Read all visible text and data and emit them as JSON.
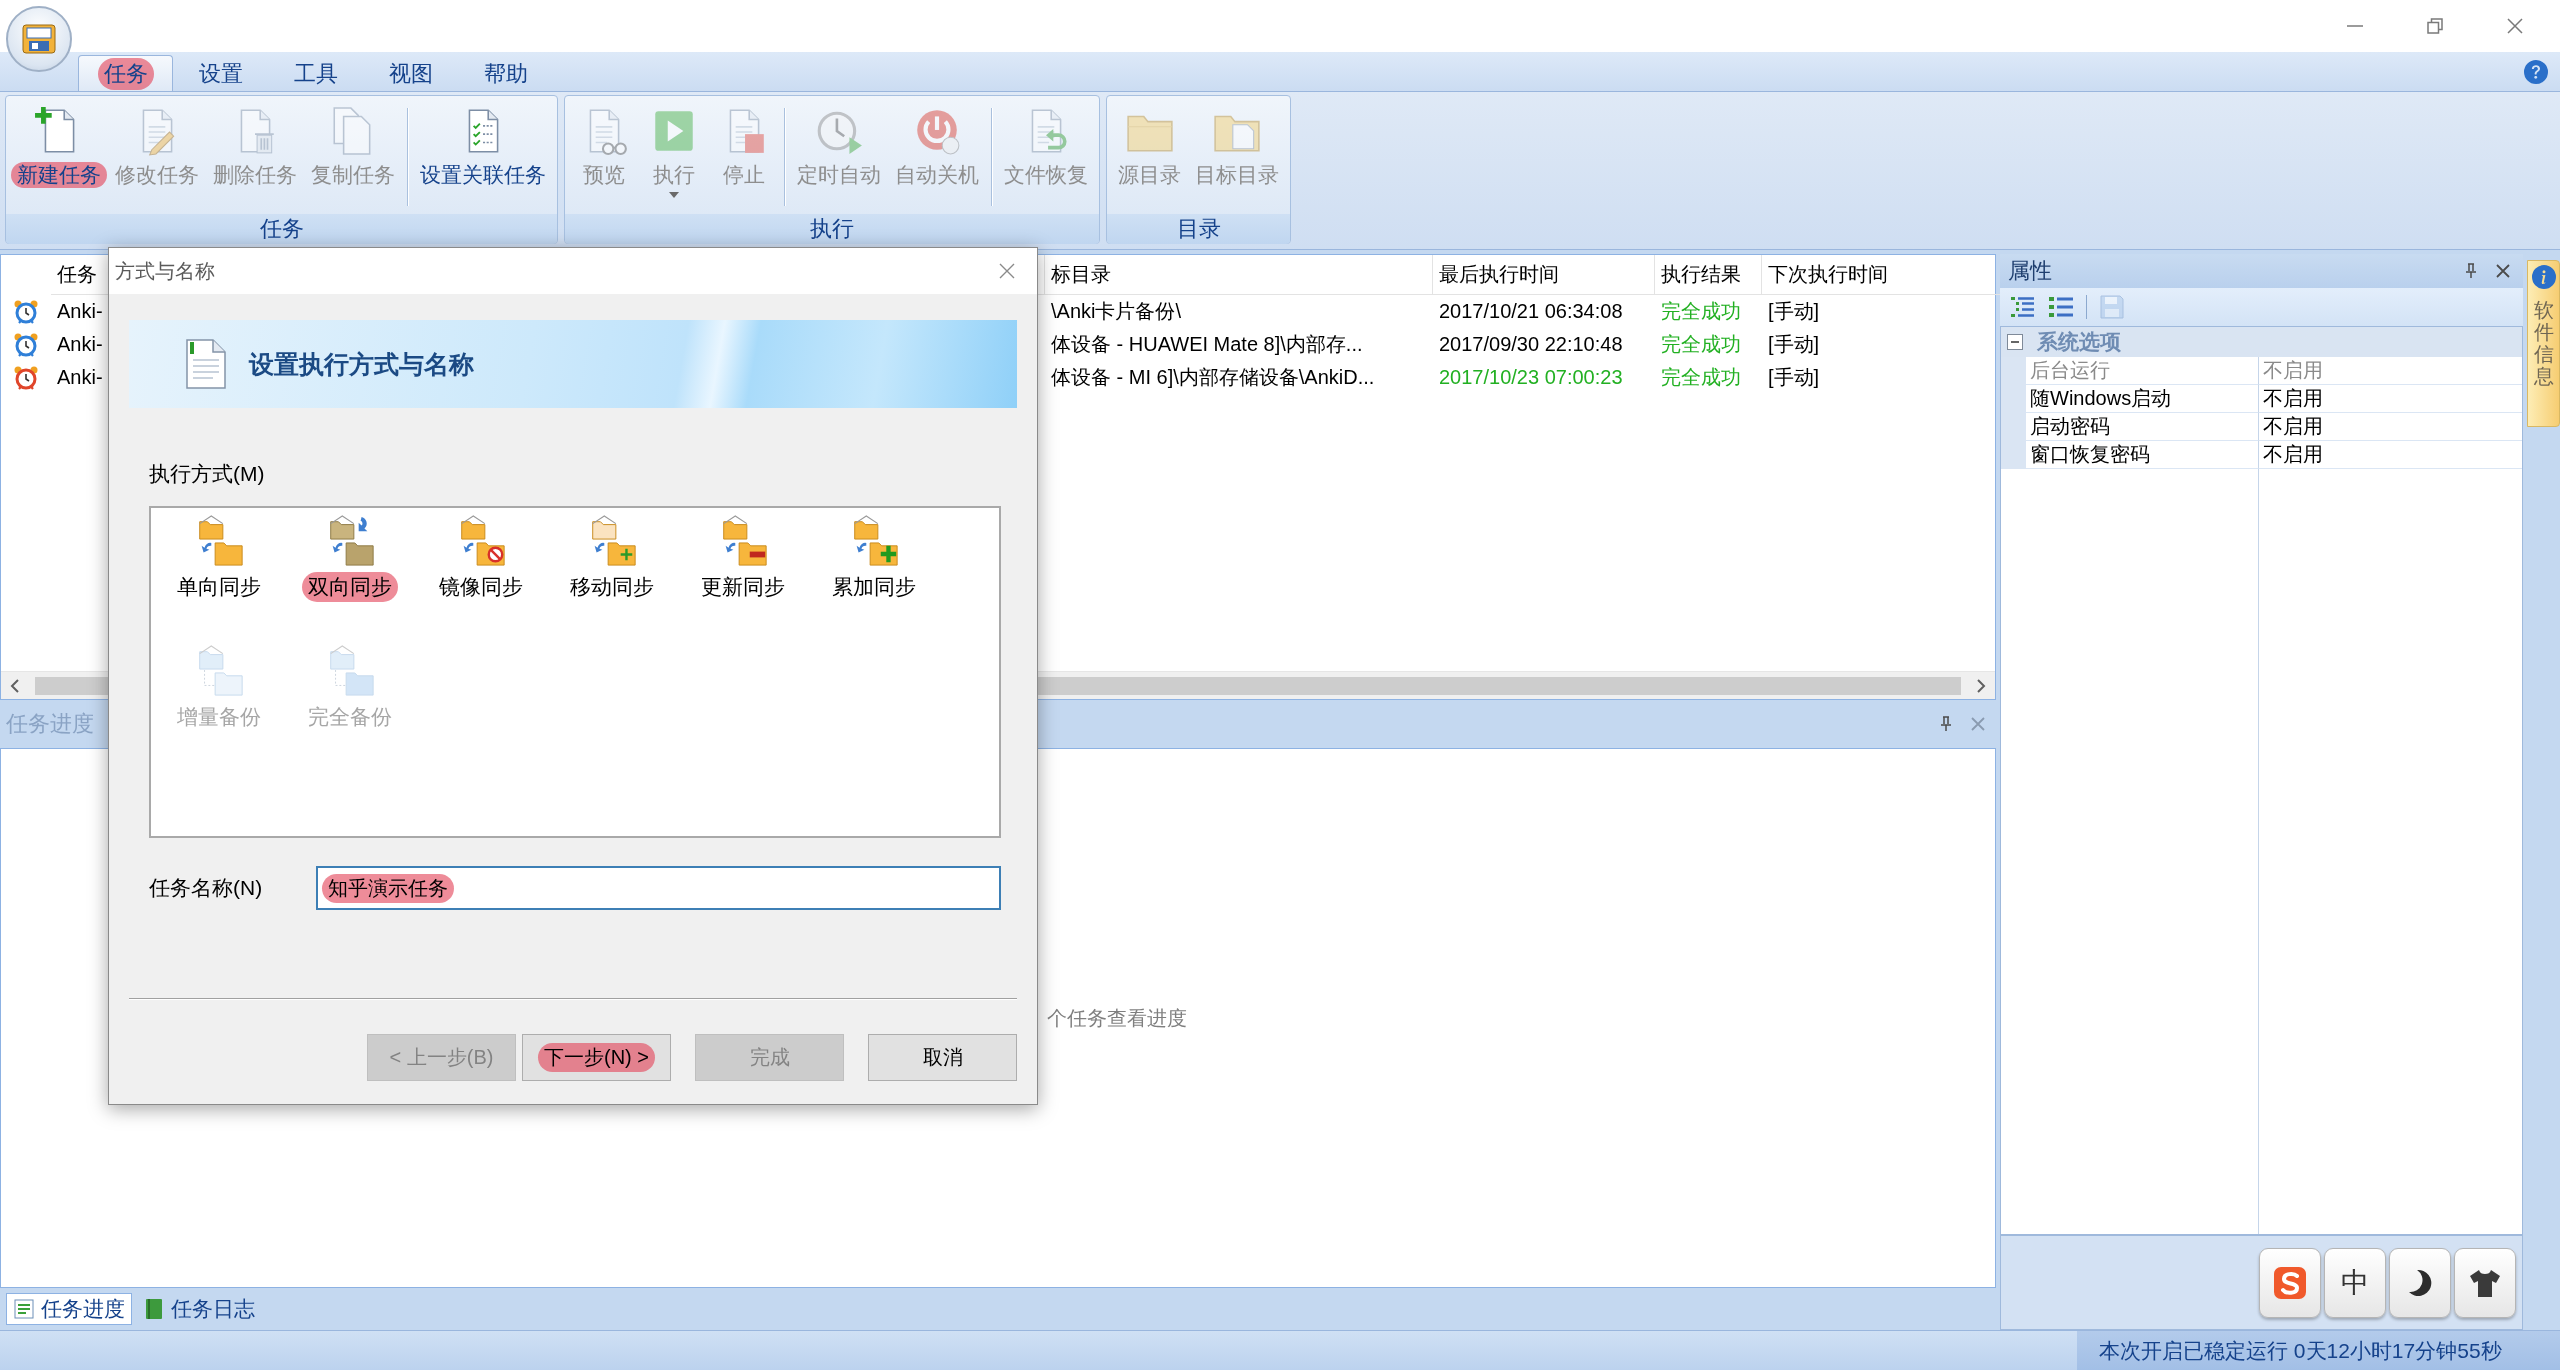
{
  "menu_tabs": [
    {
      "label": "任务",
      "selected": true,
      "highlighted": true
    },
    {
      "label": "设置",
      "selected": false,
      "highlighted": false
    },
    {
      "label": "工具",
      "selected": false,
      "highlighted": false
    },
    {
      "label": "视图",
      "selected": false,
      "highlighted": false
    },
    {
      "label": "帮助",
      "selected": false,
      "highlighted": false
    }
  ],
  "ribbon": {
    "groups": [
      {
        "label": "任务",
        "sections": [
          [
            {
              "kind": "new",
              "label": "新建任务",
              "disabled": false,
              "dropdown": false,
              "highlighted": true
            },
            {
              "kind": "edit",
              "label": "修改任务",
              "disabled": true,
              "dropdown": false,
              "highlighted": false
            },
            {
              "kind": "delete",
              "label": "删除任务",
              "disabled": true,
              "dropdown": false,
              "highlighted": false
            },
            {
              "kind": "copy",
              "label": "复制任务",
              "disabled": true,
              "dropdown": false,
              "highlighted": false
            }
          ],
          [
            {
              "kind": "link",
              "label": "设置关联任务",
              "disabled": false,
              "dropdown": false,
              "highlighted": false
            }
          ]
        ]
      },
      {
        "label": "执行",
        "sections": [
          [
            {
              "kind": "preview",
              "label": "预览",
              "disabled": true,
              "dropdown": false,
              "highlighted": false
            },
            {
              "kind": "run",
              "label": "执行",
              "disabled": true,
              "dropdown": true,
              "highlighted": false
            },
            {
              "kind": "stop",
              "label": "停止",
              "disabled": true,
              "dropdown": false,
              "highlighted": false
            }
          ],
          [
            {
              "kind": "timer",
              "label": "定时自动",
              "disabled": true,
              "dropdown": false,
              "highlighted": false
            },
            {
              "kind": "shutdown",
              "label": "自动关机",
              "disabled": true,
              "dropdown": false,
              "highlighted": false
            }
          ],
          [
            {
              "kind": "restore",
              "label": "文件恢复",
              "disabled": true,
              "dropdown": false,
              "highlighted": false
            }
          ]
        ]
      },
      {
        "label": "目录",
        "sections": [
          [
            {
              "kind": "source",
              "label": "源目录",
              "disabled": true,
              "dropdown": false,
              "highlighted": false
            },
            {
              "kind": "target",
              "label": "目标目录",
              "disabled": true,
              "dropdown": false,
              "highlighted": false
            }
          ]
        ]
      }
    ]
  },
  "task_table": {
    "columns": [
      "任务",
      "标目录",
      "最后执行时间",
      "执行结果",
      "下次执行时间"
    ],
    "rows": [
      {
        "color": "#2f7fd8",
        "cells": [
          {
            "text": "Anki-",
            "color": "#000000"
          },
          {
            "text": "\\Anki卡片备份\\",
            "color": "#000000"
          },
          {
            "text": "2017/10/21 06:34:08",
            "color": "#000000"
          },
          {
            "text": "完全成功",
            "color": "#22b022"
          },
          {
            "text": "[手动]",
            "color": "#000000"
          }
        ]
      },
      {
        "color": "#2f7fd8",
        "cells": [
          {
            "text": "Anki-",
            "color": "#000000"
          },
          {
            "text": "体设备 - HUAWEI Mate 8]\\内部存...",
            "color": "#000000"
          },
          {
            "text": "2017/09/30 22:10:48",
            "color": "#000000"
          },
          {
            "text": "完全成功",
            "color": "#22b022"
          },
          {
            "text": "[手动]",
            "color": "#000000"
          }
        ]
      },
      {
        "color": "#e0452a",
        "cells": [
          {
            "text": "Anki-",
            "color": "#000000"
          },
          {
            "text": "体设备 - MI 6]\\内部存储设备\\AnkiD...",
            "color": "#000000"
          },
          {
            "text": "2017/10/23 07:00:23",
            "color": "#22b022"
          },
          {
            "text": "完全成功",
            "color": "#22b022"
          },
          {
            "text": "[手动]",
            "color": "#000000"
          }
        ]
      }
    ]
  },
  "progress_panel": {
    "title": "任务进度",
    "hint": "个任务查看进度"
  },
  "bottom_tabs": [
    {
      "kind": "progress",
      "label": "任务进度",
      "selected": true
    },
    {
      "kind": "log",
      "label": "任务日志",
      "selected": false
    }
  ],
  "properties": {
    "title": "属性",
    "toolbar": [
      {
        "kind": "categorized",
        "disabled": false
      },
      {
        "kind": "alphabetical",
        "disabled": false
      },
      {
        "kind": "save",
        "disabled": true
      }
    ],
    "category": {
      "label": "系统选项",
      "expanded": true,
      "disabled": true
    },
    "rows": [
      {
        "name": "后台运行",
        "value": "不启用",
        "disabled": true
      },
      {
        "name": "随Windows启动",
        "value": "不启用",
        "disabled": false
      },
      {
        "name": "启动密码",
        "value": "不启用",
        "disabled": false
      },
      {
        "name": "窗口恢复密码",
        "value": "不启用",
        "disabled": false
      }
    ]
  },
  "ime_toolbar": [
    {
      "kind": "logo"
    },
    {
      "kind": "language",
      "label": "中"
    },
    {
      "kind": "moon"
    },
    {
      "kind": "shirt"
    }
  ],
  "side_tab": {
    "label": "软件信息"
  },
  "status_bar": {
    "uptime": "本次开启已稳定运行 0天12小时17分钟55秒"
  },
  "dialog": {
    "title": "方式与名称",
    "banner": "设置执行方式与名称",
    "mode_label": "执行方式(M)",
    "modes": [
      {
        "kind": "one_way",
        "label": "单向同步",
        "disabled": false,
        "highlighted": false
      },
      {
        "kind": "two_way",
        "label": "双向同步",
        "disabled": false,
        "highlighted": true
      },
      {
        "kind": "mirror",
        "label": "镜像同步",
        "disabled": false,
        "highlighted": false
      },
      {
        "kind": "move",
        "label": "移动同步",
        "disabled": false,
        "highlighted": false
      },
      {
        "kind": "update",
        "label": "更新同步",
        "disabled": false,
        "highlighted": false
      },
      {
        "kind": "accumulate",
        "label": "累加同步",
        "disabled": false,
        "highlighted": false
      },
      {
        "kind": "incremental",
        "label": "增量备份",
        "disabled": true,
        "highlighted": false
      },
      {
        "kind": "full",
        "label": "完全备份",
        "disabled": true,
        "highlighted": false
      }
    ],
    "name_label": "任务名称(N)",
    "name_field": {
      "value": "知乎演示任务",
      "highlighted": true
    },
    "buttons": [
      {
        "label": "< 上一步(B)",
        "disabled": true,
        "highlighted": false
      },
      {
        "label": "下一步(N) >",
        "disabled": false,
        "highlighted": true
      },
      {
        "label": "完成",
        "disabled": true,
        "highlighted": false
      },
      {
        "label": "取消",
        "disabled": false,
        "highlighted": false
      }
    ]
  }
}
